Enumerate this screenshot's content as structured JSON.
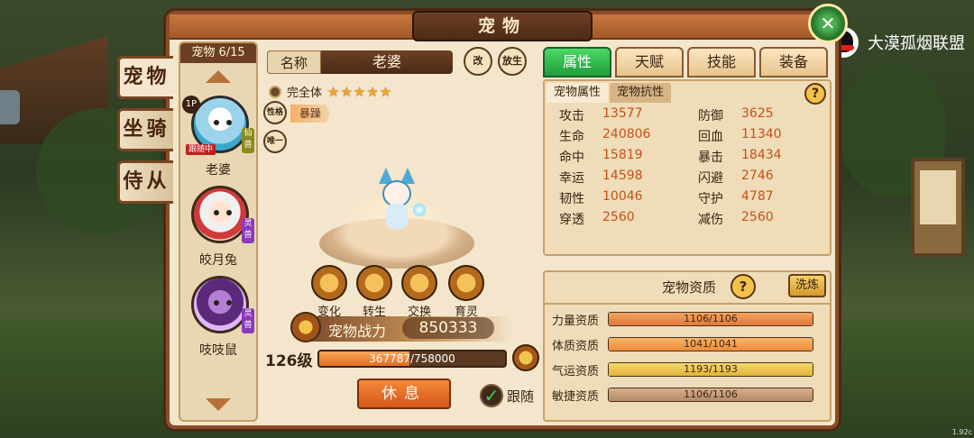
{
  "overlay": {
    "share_text": "大漠孤烟联盟"
  },
  "window": {
    "title": "宠物"
  },
  "categories": [
    {
      "label": "宠物",
      "active": true
    },
    {
      "label": "坐骑",
      "active": false
    },
    {
      "label": "侍从",
      "active": false
    }
  ],
  "pet_list": {
    "count_label": "宠物 6/15",
    "items": [
      {
        "name": "老婆",
        "position": "1P",
        "badge": "仙兽",
        "badge_color": "gold",
        "tag": "跟随中"
      },
      {
        "name": "皎月兔",
        "badge": "灵兽",
        "badge_color": "purple"
      },
      {
        "name": "吱吱鼠",
        "badge": "灵兽",
        "badge_color": "purple"
      }
    ]
  },
  "pet": {
    "name_label": "名称",
    "name": "老婆",
    "rename_icon": "改",
    "release_icon": "放生",
    "state": "完全体",
    "stars": 5,
    "stars_text": "★★★★★",
    "personality_icon": "性格",
    "personality": "暴躁",
    "unique_icon": "唯一",
    "actions": [
      {
        "label": "变化",
        "icon": "transform-icon"
      },
      {
        "label": "转生",
        "icon": "rebirth-icon"
      },
      {
        "label": "交换",
        "icon": "swap-icon"
      },
      {
        "label": "育灵",
        "icon": "nurture-icon"
      }
    ],
    "power_label": "宠物战力",
    "power": "850333",
    "level": "126级",
    "exp_text": "367787/758000",
    "exp_fraction": 0.485,
    "rest_label": "休息",
    "follow_label": "跟随",
    "follow_checked": true
  },
  "tabs": [
    {
      "label": "属性",
      "active": true
    },
    {
      "label": "天赋",
      "active": false
    },
    {
      "label": "技能",
      "active": false
    },
    {
      "label": "装备",
      "active": false
    }
  ],
  "subtabs": [
    {
      "label": "宠物属性",
      "active": true
    },
    {
      "label": "宠物抗性",
      "active": false
    }
  ],
  "stats": [
    {
      "k1": "攻击",
      "v1": "13577",
      "k2": "防御",
      "v2": "3625"
    },
    {
      "k1": "生命",
      "v1": "240806",
      "k2": "回血",
      "v2": "11340"
    },
    {
      "k1": "命中",
      "v1": "15819",
      "k2": "暴击",
      "v2": "18434"
    },
    {
      "k1": "幸运",
      "v1": "14598",
      "k2": "闪避",
      "v2": "2746"
    },
    {
      "k1": "韧性",
      "v1": "10046",
      "k2": "守护",
      "v2": "4787"
    },
    {
      "k1": "穿透",
      "v1": "2560",
      "k2": "减伤",
      "v2": "2560"
    }
  ],
  "aptitude": {
    "title": "宠物资质",
    "refine_label": "洗炼",
    "rows": [
      {
        "label": "力量资质",
        "value": "1106/1106",
        "fraction": 1.0
      },
      {
        "label": "体质资质",
        "value": "1041/1041",
        "fraction": 1.0
      },
      {
        "label": "气运资质",
        "value": "1193/1193",
        "fraction": 1.0
      },
      {
        "label": "敏捷资质",
        "value": "1106/1106",
        "fraction": 1.0
      }
    ]
  },
  "help_icon": "?",
  "version": "1.92c"
}
